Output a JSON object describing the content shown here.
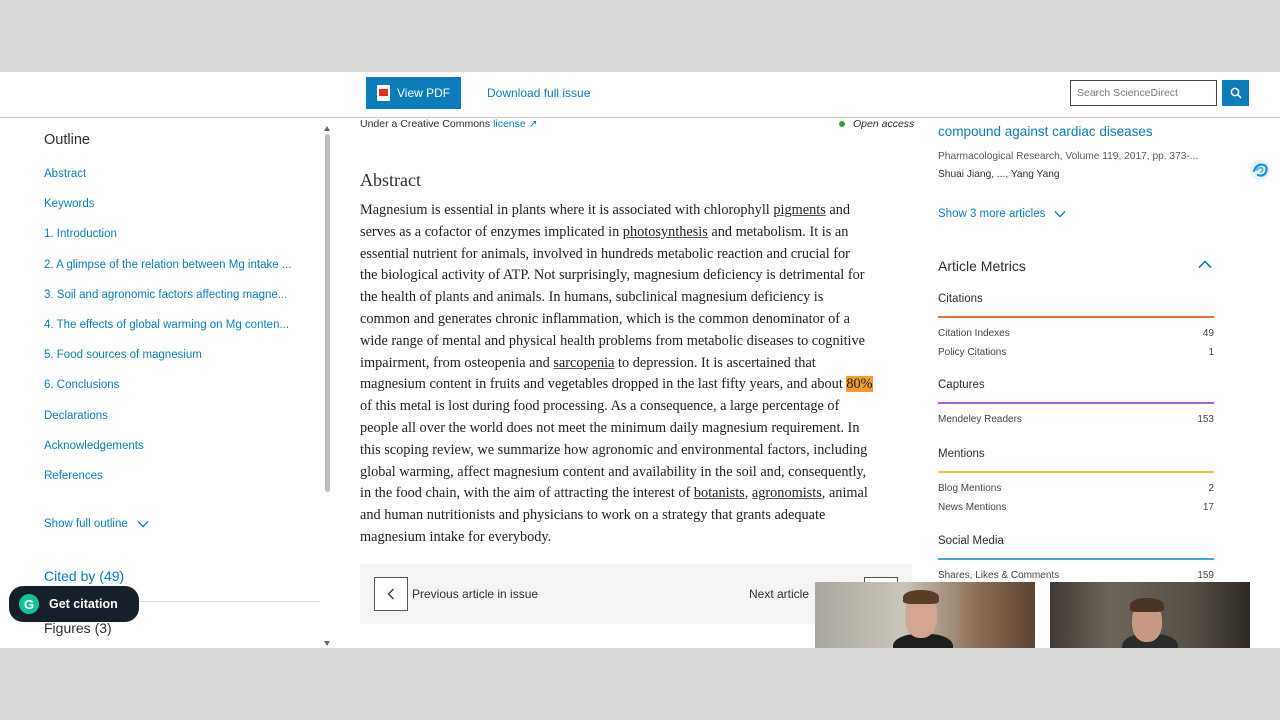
{
  "toolbar": {
    "view_pdf_label": "View PDF",
    "download_issue_label": "Download full issue",
    "search_placeholder": "Search ScienceDirect"
  },
  "outline": {
    "title": "Outline",
    "items": [
      "Abstract",
      "Keywords",
      "1. Introduction",
      "2. A glimpse of the relation between Mg intake ...",
      "3. Soil and agronomic factors affecting magne...",
      "4. The effects of global warming on Mg conten...",
      "5. Food sources of magnesium",
      "6. Conclusions",
      "Declarations",
      "Acknowledgements",
      "References"
    ],
    "show_full_label": "Show full outline",
    "cited_by_label": "Cited by (49)",
    "figures_label": "Figures (3)"
  },
  "article": {
    "license_prefix": "Under a Creative Commons",
    "license_link": "license",
    "open_access": "Open access",
    "abstract_heading": "Abstract",
    "abstract_lines": [
      [
        {
          "t": "Magnesium is essential in plants where it is associated with chlorophyll "
        },
        {
          "t": "pigments",
          "u": true
        },
        {
          "t": " and"
        }
      ],
      [
        {
          "t": "serves as a cofactor of enzymes implicated in "
        },
        {
          "t": "photosynthesis",
          "u": true
        },
        {
          "t": " and metabolism. It is an"
        }
      ],
      [
        {
          "t": "essential nutrient for animals, involved in hundreds metabolic reaction and crucial for"
        }
      ],
      [
        {
          "t": "the biological activity of ATP. Not surprisingly, magnesium deficiency is detrimental for"
        }
      ],
      [
        {
          "t": "the health of plants and animals. In humans, subclinical magnesium deficiency is"
        }
      ],
      [
        {
          "t": "common and generates chronic inflammation, which is the common denominator of a"
        }
      ],
      [
        {
          "t": "wide range of mental and physical health problems from metabolic diseases to cognitive"
        }
      ],
      [
        {
          "t": "impairment, from osteopenia and "
        },
        {
          "t": "sarcopenia",
          "u": true
        },
        {
          "t": " to depression. It is ascertained that"
        }
      ],
      [
        {
          "t": "magnesium content in fruits and vegetables dropped in the last fifty years, and about "
        },
        {
          "t": "80%",
          "hl": true
        }
      ],
      [
        {
          "t": "of this metal is lost during food processing. As a consequence, a large percentage of"
        }
      ],
      [
        {
          "t": "people all over the world does not meet the minimum daily magnesium requirement. In"
        }
      ],
      [
        {
          "t": "this scoping review, we summarize how agronomic and environmental factors, including"
        }
      ],
      [
        {
          "t": "global warming, affect magnesium content and availability in the soil and, consequently,"
        }
      ],
      [
        {
          "t": "in the food chain, with the aim of attracting the interest of "
        },
        {
          "t": "botanists",
          "u": true
        },
        {
          "t": ", "
        },
        {
          "t": "agronomists",
          "u": true
        },
        {
          "t": ", animal"
        }
      ],
      [
        {
          "t": "and human nutritionists and physicians to work on a strategy that grants adequate"
        }
      ],
      [
        {
          "t": "magnesium intake for everybody."
        }
      ]
    ],
    "prev_label": "Previous article in issue",
    "next_label": "Next article"
  },
  "related": {
    "title": "compound against cardiac diseases",
    "source": "Pharmacological Research, Volume 119, 2017, pp. 373-...",
    "authors": "Shuai Jiang, ..., Yang Yang",
    "show_more_label": "Show 3 more articles"
  },
  "metrics": {
    "heading": "Article Metrics",
    "sections": [
      {
        "title": "Citations",
        "color": "#e8703a",
        "rows": [
          {
            "label": "Citation Indexes",
            "value": "49"
          },
          {
            "label": "Policy Citations",
            "value": "1"
          }
        ]
      },
      {
        "title": "Captures",
        "color": "#b85fd6",
        "rows": [
          {
            "label": "Mendeley Readers",
            "value": "153"
          }
        ]
      },
      {
        "title": "Mentions",
        "color": "#f0c43a",
        "rows": [
          {
            "label": "Blog Mentions",
            "value": "2"
          },
          {
            "label": "News Mentions",
            "value": "17"
          }
        ]
      },
      {
        "title": "Social Media",
        "color": "#3aa8e8",
        "rows": [
          {
            "label": "Shares, Likes & Comments",
            "value": "159"
          }
        ]
      }
    ]
  },
  "citation_widget": {
    "label": "Get citation",
    "logo_letter": "G"
  },
  "colors": {
    "accent": "#0c7dbb",
    "highlight": "#f59a2e"
  }
}
